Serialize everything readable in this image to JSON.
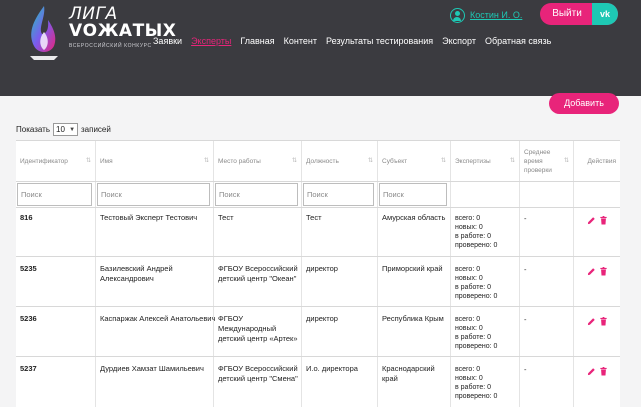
{
  "header": {
    "logo_line1": "ЛИГА",
    "logo_line2": "VОЖАТЫХ",
    "logo_sub": "Всероссийский конкурс",
    "user_name": "Костин И. О.",
    "logout_label": "Выйти",
    "vk_label": "vk",
    "nav": [
      {
        "label": "Заявки"
      },
      {
        "label": "Эксперты"
      },
      {
        "label": "Главная"
      },
      {
        "label": "Контент"
      },
      {
        "label": "Результаты тестирования"
      },
      {
        "label": "Экспорт"
      },
      {
        "label": "Обратная связь"
      }
    ]
  },
  "toolbar": {
    "add_label": "Добавить",
    "show_prefix": "Показать",
    "page_size": "10",
    "show_suffix": "записей"
  },
  "table": {
    "columns": [
      {
        "label": "Идентификатор"
      },
      {
        "label": "Имя"
      },
      {
        "label": "Место работы"
      },
      {
        "label": "Должность"
      },
      {
        "label": "Субъект"
      },
      {
        "label": "Экспертизы"
      },
      {
        "label": "Среднее время проверки"
      },
      {
        "label": "Действия"
      }
    ],
    "filter_placeholder": "Поиск",
    "rows": [
      {
        "id": "816",
        "name": "Тестовый Эксперт Тестович",
        "work": "Тест",
        "position": "Тест",
        "region": "Амурская область",
        "stats": [
          "всего: 0",
          "новых: 0",
          "в работе: 0",
          "проверено: 0"
        ],
        "avg": "-"
      },
      {
        "id": "5235",
        "name": "Базилевский Андрей Александрович",
        "work": "ФГБОУ Всероссийский детский центр \"Океан\"",
        "position": "директор",
        "region": "Приморский край",
        "stats": [
          "всего: 0",
          "новых: 0",
          "в работе: 0",
          "проверено: 0"
        ],
        "avg": "-"
      },
      {
        "id": "5236",
        "name": "Каспаржак Алексей Анатольевич",
        "work": "ФГБОУ Международный детский центр «Артек»",
        "position": "директор",
        "region": "Республика Крым",
        "stats": [
          "всего: 0",
          "новых: 0",
          "в работе: 0",
          "проверено: 0"
        ],
        "avg": "-"
      },
      {
        "id": "5237",
        "name": "Дурдиев Хамзат Шамильевич",
        "work": "ФГБОУ Всероссийский детский центр \"Смена\"",
        "position": "И.о. директора",
        "region": "Краснодарский край",
        "stats": [
          "всего: 0",
          "новых: 0",
          "в работе: 0",
          "проверено: 0"
        ],
        "avg": "-"
      }
    ]
  },
  "colors": {
    "header_bg": "#3b3b40",
    "accent_pink": "#e8247a",
    "accent_teal": "#1ec8b4"
  },
  "icons": {
    "edit": "pencil-icon",
    "delete": "trash-icon",
    "user": "user-icon"
  }
}
